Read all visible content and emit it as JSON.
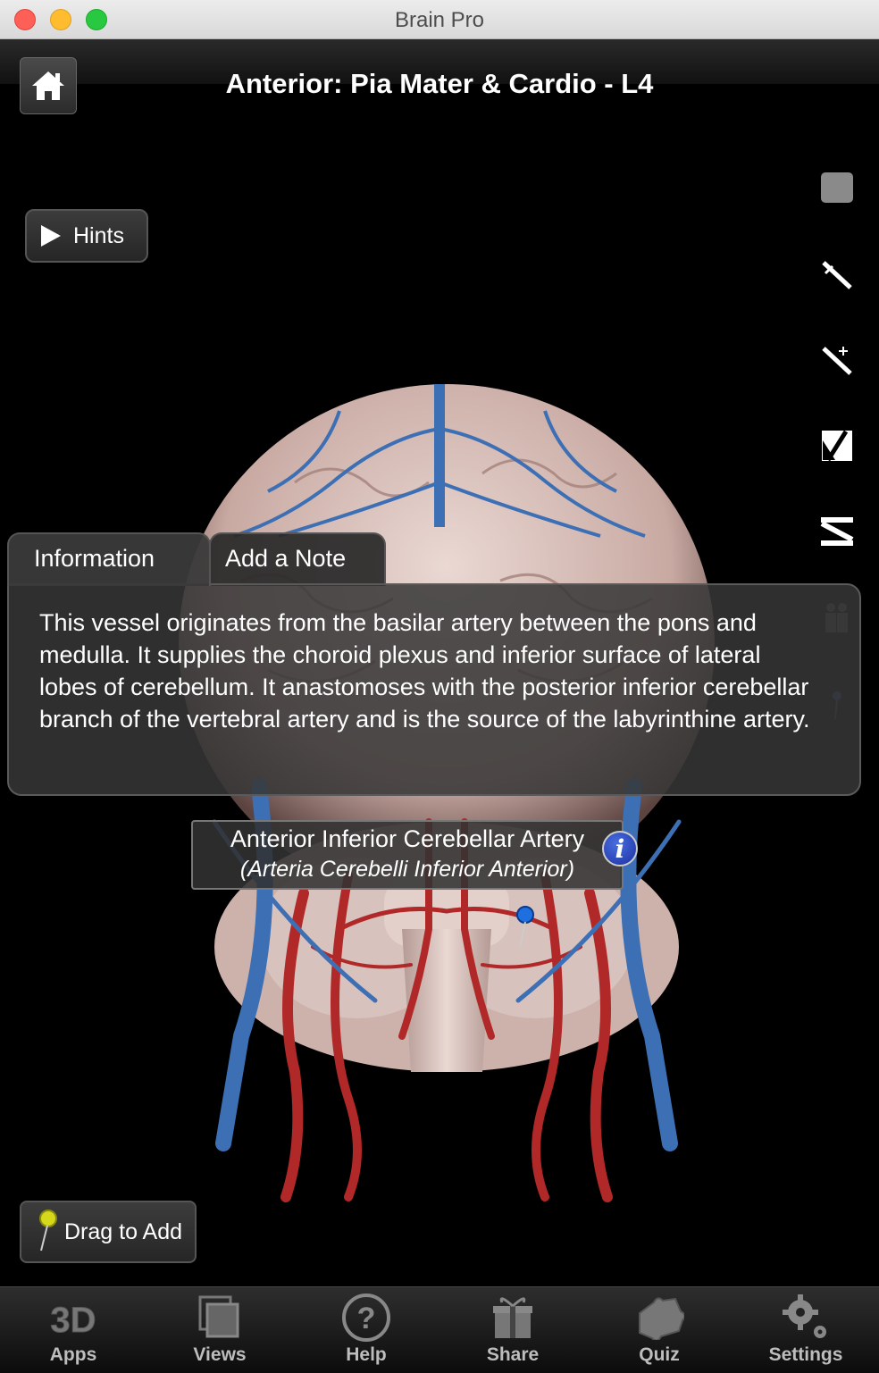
{
  "window": {
    "title": "Brain Pro"
  },
  "header": {
    "title": "Anterior: Pia Mater & Cardio - L4",
    "home_icon": "home-icon"
  },
  "hints": {
    "label": "Hints"
  },
  "info_panel": {
    "tabs": [
      {
        "label": "Information"
      },
      {
        "label": "Add a Note"
      }
    ],
    "text": "This vessel originates from the basilar artery between the pons and medulla. It supplies the choroid plexus and inferior surface of lateral lobes of cerebellum. It anastomoses with the posterior inferior cerebellar branch of the vertebral artery and is the source of the labyrinthine artery."
  },
  "label": {
    "name": "Anterior Inferior Cerebellar Artery",
    "latin": "(Arteria Cerebelli Inferior Anterior)",
    "info_icon": "i"
  },
  "drag_to_add": {
    "label": "Drag to Add"
  },
  "tabbar": {
    "items": [
      {
        "label": "Apps",
        "icon": "3d-apps-icon"
      },
      {
        "label": "Views",
        "icon": "views-icon"
      },
      {
        "label": "Help",
        "icon": "help-icon"
      },
      {
        "label": "Share",
        "icon": "gift-share-icon"
      },
      {
        "label": "Quiz",
        "icon": "puzzle-quiz-icon"
      },
      {
        "label": "Settings",
        "icon": "gear-settings-icon"
      }
    ]
  },
  "colors": {
    "artery": "#b02828",
    "vein": "#3d6fb4",
    "tissue": "#d9c4c0",
    "panel": "#373737"
  }
}
